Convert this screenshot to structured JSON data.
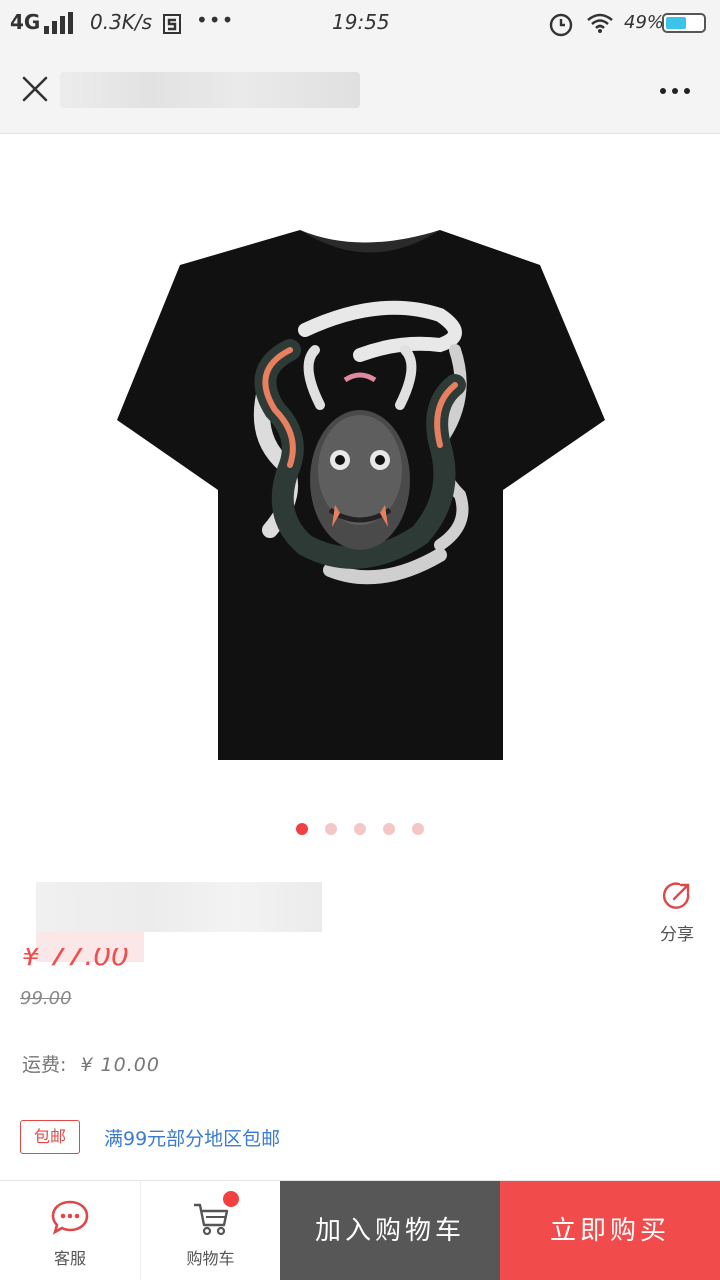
{
  "status_bar": {
    "network": "4G",
    "speed": "0.3K/s",
    "time": "19:55",
    "battery": "49%",
    "more_dots": "•••"
  },
  "nav": {
    "close_icon": "close-icon",
    "more_icon": "more-horizontal-icon"
  },
  "product": {
    "image_icon": "tshirt-product-image",
    "carousel_count": 5,
    "carousel_active": 0,
    "price": "¥ 77.00",
    "original_price": "99.00",
    "share_label": "分享",
    "shipping_label": "运费:",
    "shipping_value": "¥ 10.00",
    "free_tag": "包邮",
    "promo": "满99元部分地区包邮"
  },
  "bottom_bar": {
    "service_label": "客服",
    "cart_label": "购物车",
    "add_to_cart": "加入购物车",
    "buy_now": "立即购买"
  },
  "colors": {
    "accent": "#f24b4b",
    "dark_button": "#575757",
    "link": "#3a7bd5"
  }
}
